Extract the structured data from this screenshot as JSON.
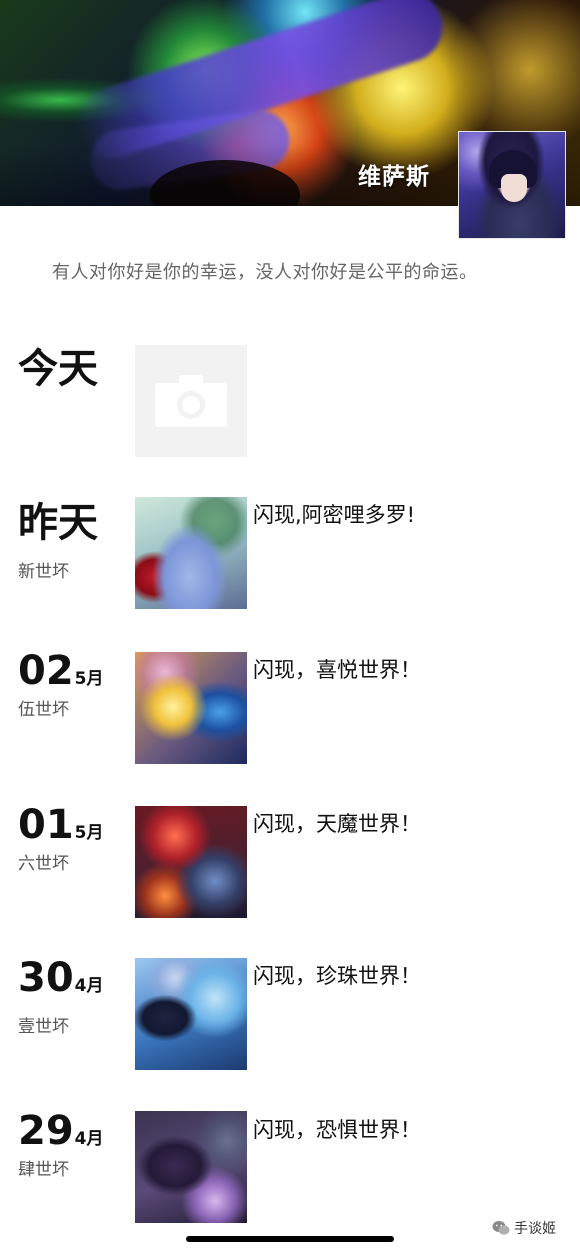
{
  "profile": {
    "name": "维萨斯",
    "signature": "有人对你好是你的幸运，没人对你好是公平的命运。"
  },
  "today": {
    "label": "今天",
    "icon": "camera-icon"
  },
  "posts": [
    {
      "day_label": "昨天",
      "location": "新世坏",
      "text": "闪现,阿密哩多罗!"
    },
    {
      "day": "02",
      "month": "5月",
      "location": "伍世坏",
      "text": "闪现，喜悦世界！"
    },
    {
      "day": "01",
      "month": "5月",
      "location": "六世坏",
      "text": "闪现，天魔世界！"
    },
    {
      "day": "30",
      "month": "4月",
      "location": "壹世坏",
      "text": "闪现，珍珠世界！"
    },
    {
      "day": "29",
      "month": "4月",
      "location": "肆世坏",
      "text": "闪现，恐惧世界！"
    }
  ],
  "watermark": {
    "text": "手谈姬",
    "icon": "wechat-logo-icon"
  }
}
